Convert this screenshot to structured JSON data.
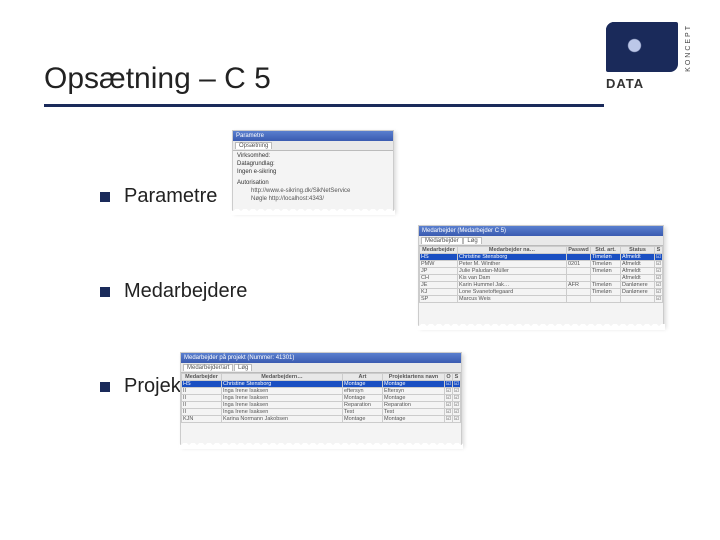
{
  "logo": {
    "vert": "KONCEPT",
    "word": "DATA"
  },
  "title": "Opsætning – C 5",
  "bullets": [
    "Parametre",
    "Medarbejdere",
    "Projekt"
  ],
  "shot1": {
    "title": "Parametre",
    "tab": "Opsætning",
    "rows": [
      {
        "l": "Virksomhed",
        "v": ""
      },
      {
        "l": "Datagrundlag",
        "v": ""
      },
      {
        "l": "Ingen e-sikring",
        "v": ""
      }
    ],
    "auth": {
      "l": "Autorisation",
      "url": "http://www.e-sikring.dk/SikNetService",
      "key": "Nøgle  http://localhost:4343/"
    }
  },
  "shot2": {
    "title": "Medarbejder (Medarbejder C 5)",
    "tabs": [
      "Medarbejder",
      "Løg"
    ],
    "cols": [
      "Medarbejder",
      "Medarbejder na…",
      "Passwd",
      "Std. art.",
      "Status",
      "S"
    ],
    "rows": [
      [
        "HS",
        "Christine Stensborg",
        "",
        "Timeløn",
        "Afmeldt",
        ""
      ],
      [
        "PMW",
        "Peter M. Winther",
        "0201",
        "Timeløn",
        "Afmeldt",
        ""
      ],
      [
        "JP",
        "Julie Paludan-Müller",
        "",
        "Timeløn",
        "Afmeldt",
        ""
      ],
      [
        "CH",
        "Kis van Dam",
        "",
        "",
        "Afmeldt",
        ""
      ],
      [
        "JE",
        "Karin Hummel Jak…",
        "AFR",
        "Timeløn",
        "Danlønere",
        ""
      ],
      [
        "KJ",
        "Lone Svanetoftegaard",
        "",
        "Timeløn",
        "Danlønere",
        ""
      ],
      [
        "SP",
        "Marcus Weis",
        "",
        "",
        "",
        ""
      ]
    ],
    "sel": 0
  },
  "shot3": {
    "title": "Medarbejder på projekt (Nummer: 41301)",
    "tabs": [
      "Medarbejder/art",
      "Løg"
    ],
    "cols": [
      "Medarbejder",
      "Medarbejdern…",
      "Art",
      "Projektartens navn",
      "O",
      "S"
    ],
    "rows": [
      [
        "HS",
        "Christine Stensborg",
        "Montage",
        "Montage",
        "",
        ""
      ],
      [
        "II",
        "Inga Irene Isaksen",
        "eftersyn",
        "Eftersyn",
        "",
        ""
      ],
      [
        "II",
        "Inga Irene Isaksen",
        "Montage",
        "Montage",
        "",
        ""
      ],
      [
        "II",
        "Inga Irene Isaksen",
        "Reparation",
        "Reparation",
        "",
        ""
      ],
      [
        "II",
        "Inga Irene Isaksen",
        "Test",
        "Test",
        "",
        ""
      ],
      [
        "KJN",
        "Karina Normann Jakobsen",
        "Montage",
        "Montage",
        "",
        ""
      ]
    ],
    "sel": 0
  }
}
